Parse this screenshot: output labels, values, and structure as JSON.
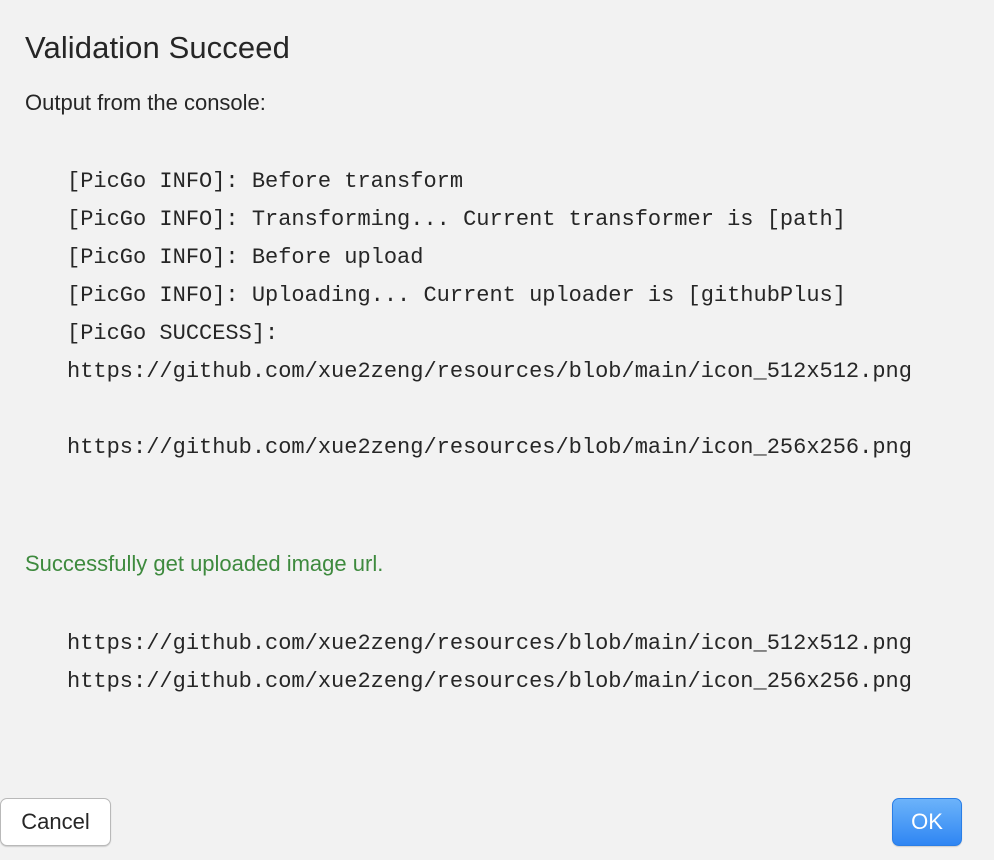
{
  "dialog": {
    "title": "Validation Succeed",
    "console_heading": "Output from the console:",
    "console_lines": [
      "[PicGo INFO]: Before transform",
      "[PicGo INFO]: Transforming... Current transformer is [path]",
      "[PicGo INFO]: Before upload",
      "[PicGo INFO]: Uploading... Current uploader is [githubPlus]",
      "[PicGo SUCCESS]:",
      "https://github.com/xue2zeng/resources/blob/main/icon_512x512.png",
      "",
      "https://github.com/xue2zeng/resources/blob/main/icon_256x256.png"
    ],
    "success_message": "Successfully get uploaded image url.",
    "uploaded_urls": [
      "https://github.com/xue2zeng/resources/blob/main/icon_512x512.png",
      "https://github.com/xue2zeng/resources/blob/main/icon_256x256.png"
    ],
    "cancel_label": "Cancel",
    "ok_label": "OK"
  },
  "colors": {
    "background": "#f2f2f2",
    "success_text": "#3e8a3e",
    "ok_button": "#2f86f3"
  }
}
